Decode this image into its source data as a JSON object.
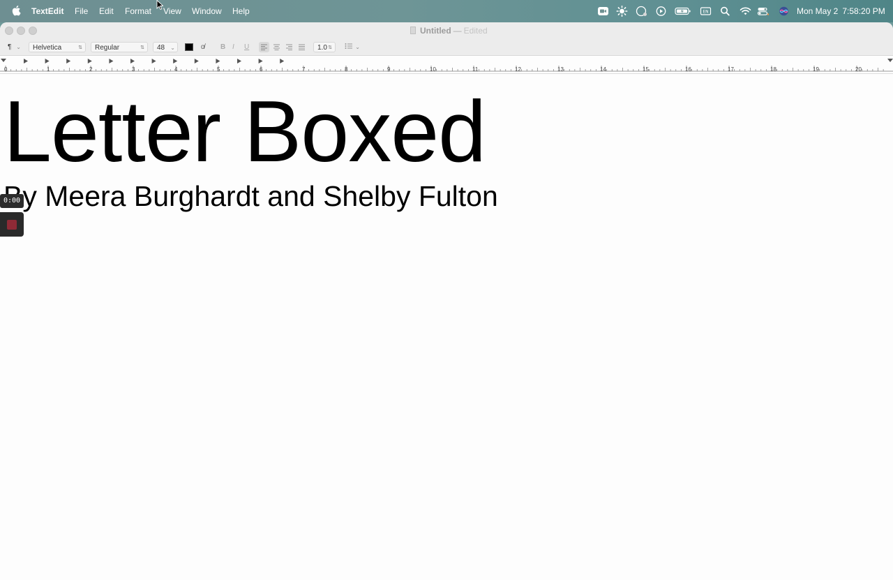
{
  "menubar": {
    "app_name": "TextEdit",
    "menus": [
      "File",
      "Edit",
      "Format",
      "View",
      "Window",
      "Help"
    ],
    "status_icons": [
      "zoom-icon",
      "brightness-icon",
      "moon-icon",
      "play-icon",
      "battery-icon",
      "keyboard-icon",
      "search-icon",
      "wifi-icon",
      "control-center-icon",
      "siri-icon"
    ],
    "clock": {
      "date": "Mon May 2",
      "time": "7:58:20 PM"
    }
  },
  "window": {
    "title": "Untitled",
    "title_separator": "—",
    "status": "Edited"
  },
  "toolbar": {
    "paragraph_style": "¶",
    "font_family": "Helvetica",
    "font_style": "Regular",
    "font_size": "48",
    "text_color": "#000000",
    "bold_label": "B",
    "italic_label": "I",
    "underline_label": "U",
    "line_spacing": "1.0"
  },
  "ruler": {
    "labels": [
      "0",
      "1",
      "2",
      "3",
      "4",
      "5",
      "6",
      "7",
      "8",
      "9",
      "10",
      "11",
      "12",
      "13",
      "14",
      "15",
      "16",
      "17",
      "18",
      "19",
      "20"
    ]
  },
  "document": {
    "title": "Letter Boxed",
    "subtitle": "By Meera Burghardt and Shelby Fulton"
  },
  "recording": {
    "timer": "0:00",
    "stop_color": "#8f2a36"
  }
}
